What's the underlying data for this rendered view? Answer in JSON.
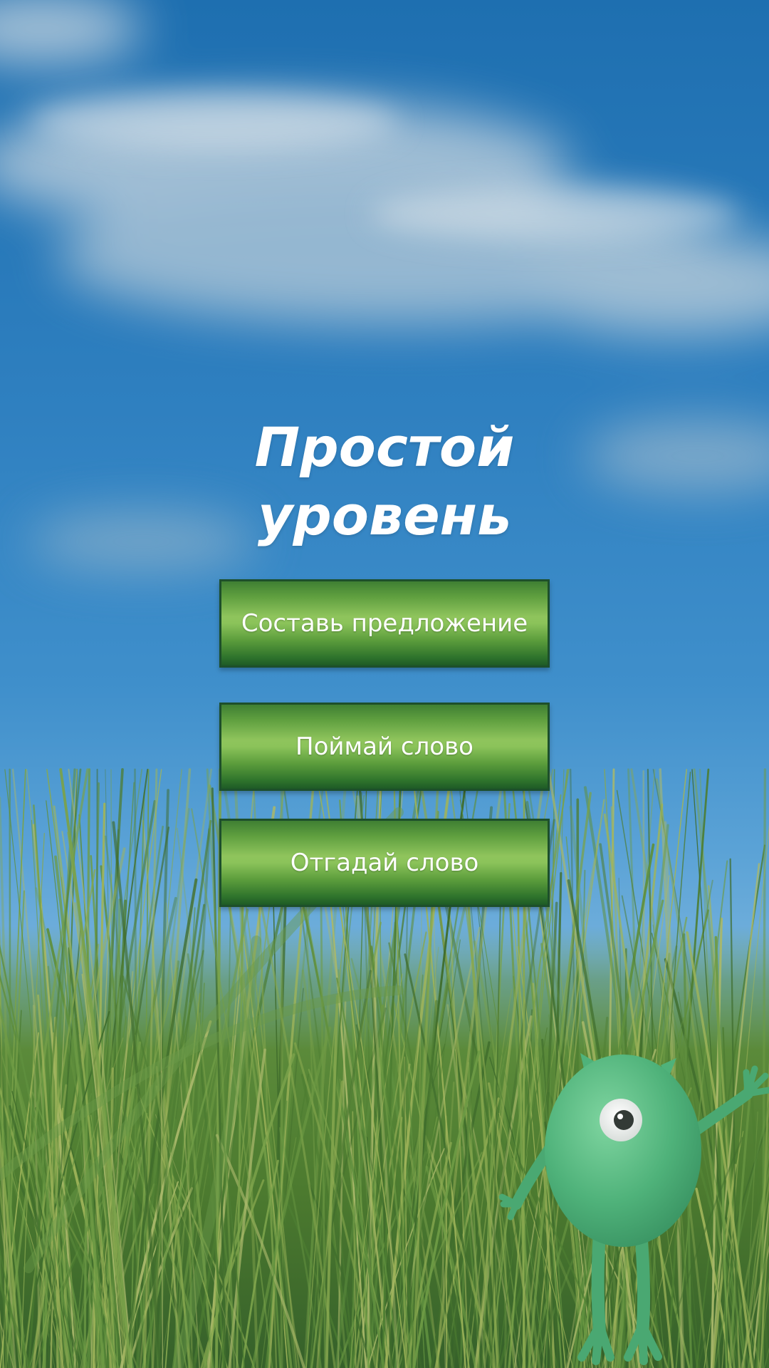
{
  "title": {
    "line1": "Простой",
    "line2": "уровень"
  },
  "menu": {
    "items": [
      {
        "label": "Составь предложение"
      },
      {
        "label": "Поймай слово"
      },
      {
        "label": "Отгадай слово"
      }
    ]
  },
  "colors": {
    "sky_top": "#1e6fb0",
    "sky_bottom": "#8fc1de",
    "button_green": "#5c9d3c",
    "button_border": "#1d4f2b",
    "grass": "#4f7f34",
    "monster": "#4fb27a"
  },
  "icons": {
    "mascot": "one-eyed-green-monster"
  }
}
